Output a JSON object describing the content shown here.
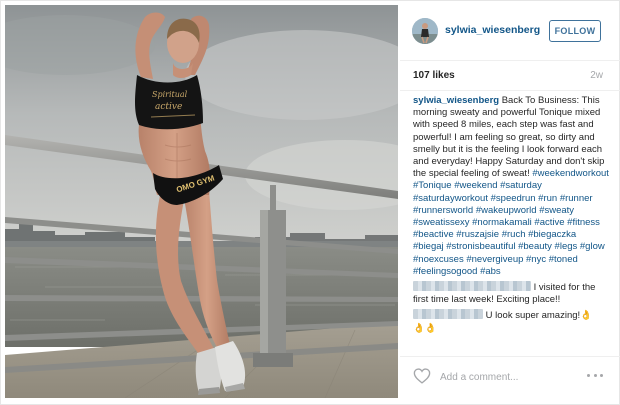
{
  "post": {
    "header": {
      "username": "sylwia_wiesenberg",
      "follow_label": "FOLLOW"
    },
    "meta": {
      "likes": "107 likes",
      "age": "2w"
    },
    "caption": {
      "username": "sylwia_wiesenberg",
      "text": "Back To Business: This morning sweaty and powerful Tonique mixed with speed 8 miles, each step was fast and powerful! I am feeling so great, so dirty and smelly but it is the feeling I look forward each and everyday! Happy Saturday and don't skip the special feeling of sweat!",
      "hashtags": "#weekendworkout #Tonique #weekend #saturday #saturdayworkout #speedrun #run #runner #runnersworld #wakeupworld #sweaty #sweatissexy #normakamali #active #fitness #beactive #ruszajsie #ruch #biegaczka #biegaj #stronisbeautiful #beauty #legs #glow #noexcuses #nevergiveup #nyc #toned #feelingsogood #abs"
    },
    "comments": [
      {
        "text": "I visited for the first time last week! Exciting place!!"
      },
      {
        "text": "U look super amazing!",
        "emoji_inline": "👌",
        "emoji_line": "👌👌"
      }
    ],
    "add_comment": {
      "placeholder": "Add a comment..."
    },
    "photo": {
      "top_text": "Spiritual active",
      "shorts_text": "OMO GYM"
    },
    "colors": {
      "link": "#125688",
      "follow": "#3f729b",
      "muted": "#a5a7aa",
      "border": "#efefef"
    },
    "icons": [
      "heart-icon",
      "more-options-icon"
    ]
  }
}
